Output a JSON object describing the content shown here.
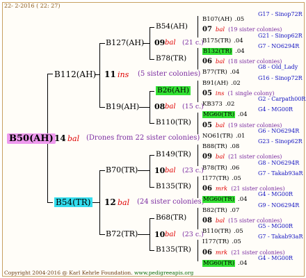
{
  "header": {
    "date_text": "22-  2-2016 ( 22: 27)"
  },
  "root": {
    "label": "B50(AH)",
    "highlight": "#ee99ee"
  },
  "gen1": {
    "num": "14",
    "mark": "bal",
    "note": "(Drones from 22 sister colonies)",
    "father": {
      "label": "B112(AH)",
      "num": "11",
      "mark": "ins",
      "note": "(5 sister colonies)"
    },
    "mother": {
      "label": "B54(TR)",
      "highlight": "#33ddee",
      "num": "12",
      "mark": "bal",
      "note": "(24 sister colonies)"
    }
  },
  "gen2": {
    "b127": {
      "label": "B127(AH)",
      "num": "09",
      "mark": "bal",
      "note": "(21 c.)"
    },
    "b19": {
      "label": "B19(AH)",
      "num": "08",
      "mark": "bal",
      "note": "(15 c.)"
    },
    "b70": {
      "label": "B70(TR)",
      "num": "10",
      "mark": "bal",
      "note": "(23 c.)"
    },
    "b72": {
      "label": "B72(TR)",
      "num": "10",
      "mark": "bal",
      "note": "(23 c.)"
    }
  },
  "gen3": {
    "b54ah": "B54(AH)",
    "b78tr_a": "B78(TR)",
    "b26ah": "B26(AH)",
    "b110tr": "B110(TR)",
    "b149tr": "B149(TR)",
    "b135tr_a": "B135(TR)",
    "b68tr": "B68(TR)",
    "b135tr_b": "B135(TR)",
    "b26ah_highlight": "#33e033"
  },
  "leaves": [
    {
      "id": "B107(AH)",
      "val": ".05",
      "code": "G17 - Sinop72R"
    },
    {
      "num": "07",
      "mark": "bal",
      "note": "(19 sister colonies)"
    },
    {
      "id": "B175(TR)",
      "val": ".04",
      "code": "G21 - Sinop62R"
    },
    {
      "id": "B132(TR)",
      "val": ".04",
      "code": "G7 - NO6294R",
      "hl": true
    },
    {
      "num": "06",
      "mark": "bal",
      "note": "(18 sister colonies)"
    },
    {
      "id": "B77(TR)",
      "val": ".04",
      "code": "G8 - Old_Lady"
    },
    {
      "id": "B91(AH)",
      "val": ".02",
      "code": "G16 - Sinop72R"
    },
    {
      "num": "05",
      "mark": "ins",
      "note": "(1 single colony)"
    },
    {
      "id": "KB373",
      "val": ".02",
      "code": "G2 - Carpath00R"
    },
    {
      "id": "MG60(TR)",
      "val": ".04",
      "code": "G4 - MG00R",
      "hl": true
    },
    {
      "num": "05",
      "mark": "bal",
      "note": "(19 sister colonies)"
    },
    {
      "id": "NO61(TR)",
      "val": ".01",
      "code": "G6 - NO6294R"
    },
    {
      "id": "B88(TR)",
      "val": ".08",
      "code": "G23 - Sinop62R"
    },
    {
      "num": "09",
      "mark": "bal",
      "note": "(21 sister colonies)"
    },
    {
      "id": "B78(TR)",
      "val": ".06",
      "code": "G8 - NO6294R"
    },
    {
      "id": "I177(TR)",
      "val": ".05",
      "code": "G7 - Takab93aR"
    },
    {
      "num": "06",
      "mark": "mrk",
      "note": "(21 sister colonies)"
    },
    {
      "id": "MG60(TR)",
      "val": ".04",
      "code": "G4 - MG00R",
      "hl": true
    },
    {
      "id": "B82(TR)",
      "val": ".07",
      "code": "G9 - NO6294R"
    },
    {
      "num": "08",
      "mark": "bal",
      "note": "(15 sister colonies)"
    },
    {
      "id": "B110(TR)",
      "val": ".05",
      "code": "G5 - MG00R"
    },
    {
      "id": "I177(TR)",
      "val": ".05",
      "code": "G7 - Takab93aR"
    },
    {
      "num": "06",
      "mark": "mrk",
      "note": "(21 sister colonies)"
    },
    {
      "id": "MG60(TR)",
      "val": ".04",
      "code": "G4 - MG00R",
      "hl": true
    }
  ],
  "footer": {
    "copyright": "Copyright 2004-2016 @ Karl Kehrle Foundation.",
    "url": "www.pedigreeapis.org"
  },
  "colors": {
    "line": "#000000",
    "note": "#7a2aa0",
    "mark": "#e00000",
    "code": "#1010c0"
  }
}
